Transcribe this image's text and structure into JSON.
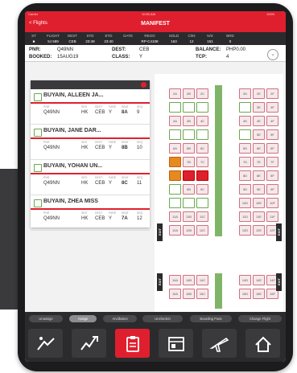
{
  "status_bar": {
    "carrier": "Carrier",
    "time": "10:50 AM",
    "battery": "100%"
  },
  "header": {
    "back_label": "< Flights",
    "title": "MANIFEST"
  },
  "flight_info": {
    "headers": [
      "ST",
      "FLIGHT",
      "DEST",
      "STD",
      "ETD",
      "GATE",
      "REGO",
      "SOLD",
      "C/IN",
      "N/S",
      "BRD"
    ],
    "values": [
      "",
      "5J 589",
      "CEB",
      "23:49",
      "23:40",
      "",
      "RP-C4108",
      "163",
      "12",
      "151",
      "0"
    ]
  },
  "pnr_info": {
    "pnr_label": "PNR:",
    "pnr_value": "Q49NN",
    "dest_label": "DEST:",
    "dest_value": "CEB",
    "balance_label": "BALANCE:",
    "balance_value": "PHP0.00",
    "booked_label": "BOOKED:",
    "booked_value": "15AUG19",
    "class_label": "CLASS:",
    "class_value": "Y",
    "tcp_label": "TCP:",
    "tcp_value": "4"
  },
  "passenger_columns": [
    "PNR",
    "SEG",
    "DEST",
    "FARE",
    "SEAT",
    "SEQ"
  ],
  "passengers": [
    {
      "name": "BUYAIN, ALLEEN JA...",
      "pnr": "Q49NN",
      "seg": "HK",
      "dest": "CEB",
      "fare": "Y",
      "seat": "8A",
      "seq": "9"
    },
    {
      "name": "BUYAIN, JANE DAR...",
      "pnr": "Q49NN",
      "seg": "HK",
      "dest": "CEB",
      "fare": "Y",
      "seat": "8B",
      "seq": "10"
    },
    {
      "name": "BUYAIN, YOHAN UN...",
      "pnr": "Q49NN",
      "seg": "HK",
      "dest": "CEB",
      "fare": "Y",
      "seat": "8C",
      "seq": "11"
    },
    {
      "name": "BUYAIN, ZHEA MISS",
      "pnr": "Q49NN",
      "seg": "HK",
      "dest": "CEB",
      "fare": "Y",
      "seat": "7A",
      "seq": "12"
    }
  ],
  "seat_rows": [
    {
      "row": "2",
      "left": [
        "2A",
        "2B",
        "2C"
      ],
      "right": [
        "2D",
        "2E",
        "2F"
      ]
    },
    {
      "row": "3",
      "left": [
        "",
        "",
        ""
      ],
      "right": [
        "",
        "3E",
        "3F"
      ]
    },
    {
      "row": "4",
      "left": [
        "4A",
        "4B",
        "4C"
      ],
      "right": [
        "4D",
        "4E",
        "4F"
      ]
    },
    {
      "row": "5",
      "left": [
        "",
        "",
        ""
      ],
      "right": [
        "",
        "5E",
        "5F"
      ]
    },
    {
      "row": "6",
      "left": [
        "6A",
        "6B",
        "6C"
      ],
      "right": [
        "6D",
        "6E",
        "6F"
      ]
    },
    {
      "row": "7",
      "left": [
        "",
        "7B",
        "7C"
      ],
      "right": [
        "7D",
        "7E",
        "7F"
      ]
    },
    {
      "row": "8",
      "left": [
        "",
        "",
        ""
      ],
      "right": [
        "8D",
        "8E",
        "8F"
      ]
    },
    {
      "row": "9",
      "left": [
        "",
        "9B",
        "9C"
      ],
      "right": [
        "9D",
        "9E",
        "9F"
      ]
    },
    {
      "row": "10",
      "left": [
        "",
        "",
        ""
      ],
      "right": [
        "10D",
        "10E",
        "10F"
      ]
    },
    {
      "row": "11",
      "left": [
        "11A",
        "11B",
        "11C"
      ],
      "right": [
        "11D",
        "11E",
        "11F"
      ]
    },
    {
      "row": "12",
      "left": [
        "12A",
        "12B",
        "12C"
      ],
      "right": [
        "12D",
        "12E",
        "12F"
      ]
    },
    {
      "row": "14",
      "left": [
        "14A",
        "14B",
        "14C"
      ],
      "right": [
        "14D",
        "14E",
        "14F"
      ]
    },
    {
      "row": "15",
      "left": [
        "15A",
        "15B",
        "15C"
      ],
      "right": [
        "15D",
        "15E",
        "15F"
      ]
    }
  ],
  "exit_label": "EXIT",
  "actions": [
    "Unassign",
    "Assign",
    "Ancillaries",
    "Uncheckin",
    "Boarding Pass",
    "Change Flight"
  ],
  "tabs": [
    {
      "icon": "checkin-icon",
      "label": "Check-in"
    },
    {
      "icon": "boarding-icon",
      "label": "Boarding"
    },
    {
      "icon": "manifest-icon",
      "label": "Manifest"
    },
    {
      "icon": "list-icon",
      "label": "List"
    },
    {
      "icon": "plane-icon",
      "label": "Flights"
    },
    {
      "icon": "home-icon",
      "label": "Home"
    }
  ],
  "colors": {
    "brand_red": "#e01f2e",
    "dark_bar": "#2b2b2d",
    "occupied_green": "#6aa84f",
    "selected_orange": "#e8891e"
  }
}
